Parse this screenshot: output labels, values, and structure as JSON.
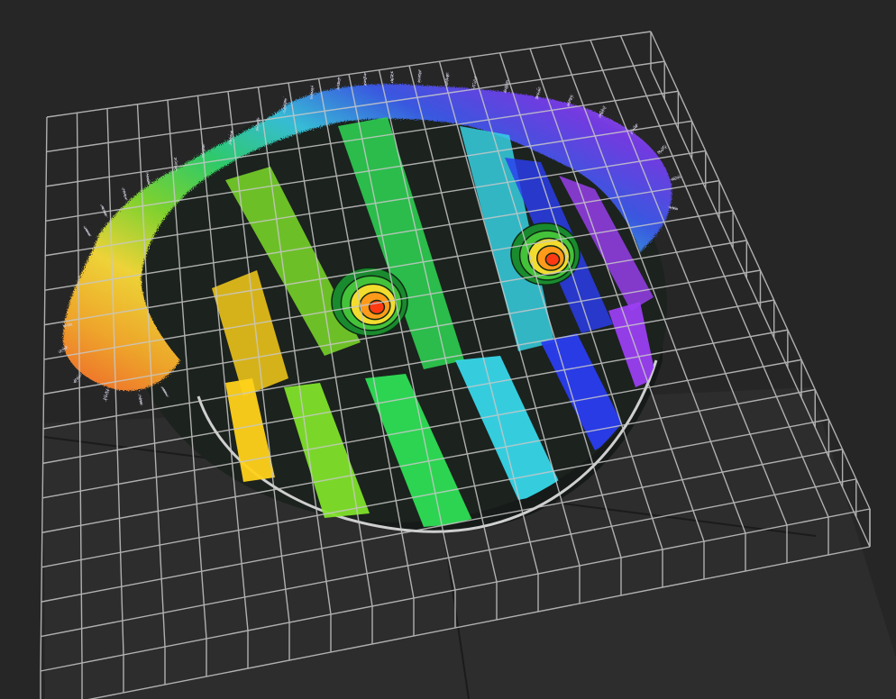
{
  "scene": {
    "background_color": "#262626",
    "floor_color": "#2d2d2d",
    "floor_seam_color": "#1b1b1b",
    "grid_color": "#c8c8c8",
    "wafer_base_color": "#1c221e",
    "wafer_rim_color": "#cfcfcf",
    "spike_color": "#d9d4e6",
    "stripe_colors": [
      "#ffd21a",
      "#7fe22a",
      "#2ede55",
      "#37d7e9",
      "#2a3df0",
      "#9a3ff2"
    ],
    "edge_gradient": [
      "#ff6a2a",
      "#ffb02a",
      "#ffe23a",
      "#86e030",
      "#2fd870",
      "#39c9e6",
      "#3b5cf0",
      "#7a3cf0",
      "#c86af8"
    ],
    "spiral_marks": [
      {
        "name": "spiral-left",
        "rings": [
          "#1a8a2e",
          "#44c23a",
          "#f2dc2e",
          "#ff9a1a",
          "#ff3a12"
        ]
      },
      {
        "name": "spiral-right",
        "rings": [
          "#1a8a2e",
          "#44c23a",
          "#f2dc2e",
          "#ff9a1a",
          "#ff3a12"
        ]
      }
    ]
  }
}
